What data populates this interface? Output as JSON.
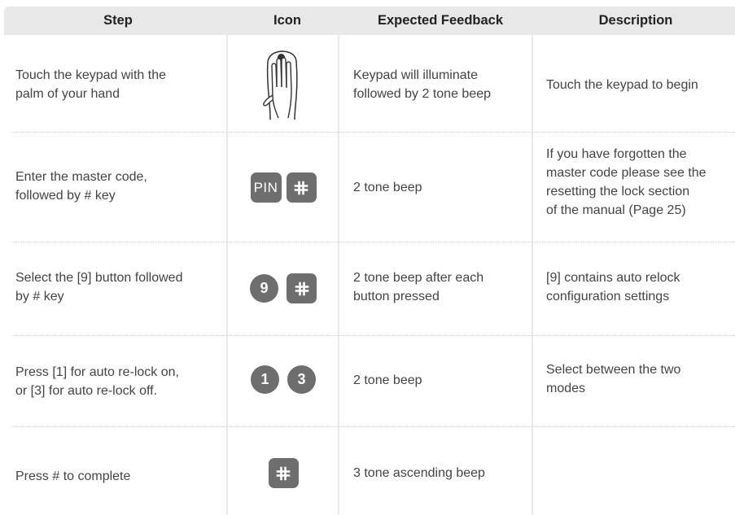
{
  "headers": {
    "step": "Step",
    "icon": "Icon",
    "feedback": "Expected Feedback",
    "description": "Description"
  },
  "rows": [
    {
      "step": [
        "Touch the keypad with the",
        "palm of your hand"
      ],
      "icon": "hand-palm-icon",
      "feedback": [
        "Keypad will illuminate",
        "followed by 2 tone beep"
      ],
      "description": [
        "Touch the keypad to begin"
      ]
    },
    {
      "step": [
        "Enter the master code,",
        "followed by # key"
      ],
      "icon": "pin-key-and-hash-key",
      "icon_text": "PIN",
      "feedback": [
        "2 tone beep"
      ],
      "description": [
        "If you have forgotten the",
        "master code please see the",
        "resetting the lock section",
        "of the manual (Page 25)"
      ]
    },
    {
      "step": [
        "Select the [9] button followed",
        "by # key"
      ],
      "icon": "key-9-and-hash-key",
      "icon_text": "9",
      "feedback": [
        "2 tone beep after each",
        "button pressed"
      ],
      "description": [
        "[9] contains auto relock",
        "configuration settings"
      ]
    },
    {
      "step": [
        "Press [1] for auto re-lock on,",
        "or [3] for auto re-lock off."
      ],
      "icon": "key-1-and-key-3",
      "icon_text": [
        "1",
        "3"
      ],
      "feedback": [
        "2 tone beep"
      ],
      "description": [
        "Select between the two",
        "modes"
      ]
    },
    {
      "step": [
        "Press # to complete"
      ],
      "icon": "hash-key",
      "feedback": [
        "3 tone ascending beep"
      ],
      "description": []
    }
  ],
  "colors": {
    "header_bg": "#e8e8e8",
    "key_fill": "#6e6e6e",
    "divider": "#e9e9e9",
    "dotted_rule": "#cfcfcf",
    "text": "#444444"
  }
}
